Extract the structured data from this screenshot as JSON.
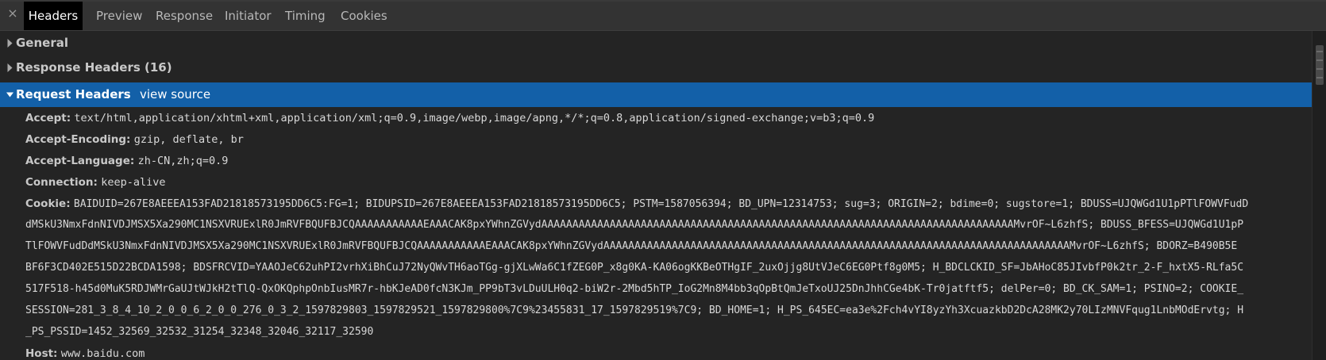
{
  "tabs": [
    {
      "label": "Headers",
      "active": true
    },
    {
      "label": "Preview",
      "active": false
    },
    {
      "label": "Response",
      "active": false
    },
    {
      "label": "Initiator",
      "active": false
    },
    {
      "label": "Timing",
      "active": false
    },
    {
      "label": "Cookies",
      "active": false
    }
  ],
  "close_glyph": "×",
  "sections": {
    "general": {
      "label": "General",
      "expanded": false
    },
    "response_headers": {
      "label": "Response Headers (16)",
      "expanded": false
    },
    "request_headers": {
      "label": "Request Headers",
      "expanded": true,
      "view_source_label": "view source"
    }
  },
  "request_headers": {
    "accept": {
      "name": "Accept:",
      "value": "text/html,application/xhtml+xml,application/xml;q=0.9,image/webp,image/apng,*/*;q=0.8,application/signed-exchange;v=b3;q=0.9"
    },
    "accept_encoding": {
      "name": "Accept-Encoding:",
      "value": "gzip, deflate, br"
    },
    "accept_language": {
      "name": "Accept-Language:",
      "value": "zh-CN,zh;q=0.9"
    },
    "connection": {
      "name": "Connection:",
      "value": "keep-alive"
    },
    "cookie": {
      "name": "Cookie:",
      "lines": [
        "BAIDUID=267E8AEEEA153FAD21818573195DD6C5:FG=1; BIDUPSID=267E8AEEEA153FAD21818573195DD6C5; PSTM=1587056394; BD_UPN=12314753; sug=3; ORIGIN=2; bdime=0; sugstore=1; BDUSS=UJQWGd1U1pPTlFOWVFudD",
        "dMSkU3NmxFdnNIVDJMSX5Xa290MC1NSXVRUExlR0JmRVFBQUFBJCQAAAAAAAAAAAEAAACAK8pxYWhnZGVydAAAAAAAAAAAAAAAAAAAAAAAAAAAAAAAAAAAAAAAAAAAAAAAAAAAAAAAAAAAAAAAAAAAAAAAAAAAAMvrOF~L6zhfS; BDUSS_BFESS=UJQWGd1U1pP",
        "TlFOWVFudDdMSkU3NmxFdnNIVDJMSX5Xa290MC1NSXVRUExlR0JmRVFBQUFBJCQAAAAAAAAAAAEAAACAK8pxYWhnZGVydAAAAAAAAAAAAAAAAAAAAAAAAAAAAAAAAAAAAAAAAAAAAAAAAAAAAAAAAAAAAAAAAAAAAAAAAAAAMvrOF~L6zhfS; BDORZ=B490B5E",
        "BF6F3CD402E515D22BCDA1598; BDSFRCVID=YAAOJeC62uhPI2vrhXiBhCuJ72NyQWvTH6aoTGg-gjXLwWa6C1fZEG0P_x8g0KA-KA06ogKKBeOTHgIF_2uxOjjg8UtVJeC6EG0Ptf8g0M5; H_BDCLCKID_SF=JbAHoC85JIvbfP0k2tr_2-F_hxtX5-RLfa5C",
        "517F518-h45d0MuK5RDJWMrGaUJtWJkH2tTlQ-QxOKQphpOnbIusMR7r-hbKJeAD0fcN3KJm_PP9bT3vLDuULH0q2-biW2r-2Mbd5hTP_IoG2Mn8M4bb3qOpBtQmJeTxoUJ25DnJhhCGe4bK-Tr0jatftf5; delPer=0; BD_CK_SAM=1; PSINO=2; COOKIE_",
        "SESSION=281_3_8_4_10_2_0_0_6_2_0_0_276_0_3_2_1597829803_1597829521_1597829800%7C9%23455831_17_1597829519%7C9; BD_HOME=1; H_PS_645EC=ea3e%2Fch4vYI8yzYh3XcuazkbD2DcA28MK2y70LIzMNVFqug1LnbMOdErvtg; H",
        "_PS_PSSID=1452_32569_32532_31254_32348_32046_32117_32590"
      ]
    },
    "host": {
      "name": "Host:",
      "value": "www.baidu.com"
    }
  },
  "colors": {
    "background": "#242424",
    "tabbar": "#333333",
    "active_tab": "#000000",
    "selected_row": "#1360a8"
  }
}
